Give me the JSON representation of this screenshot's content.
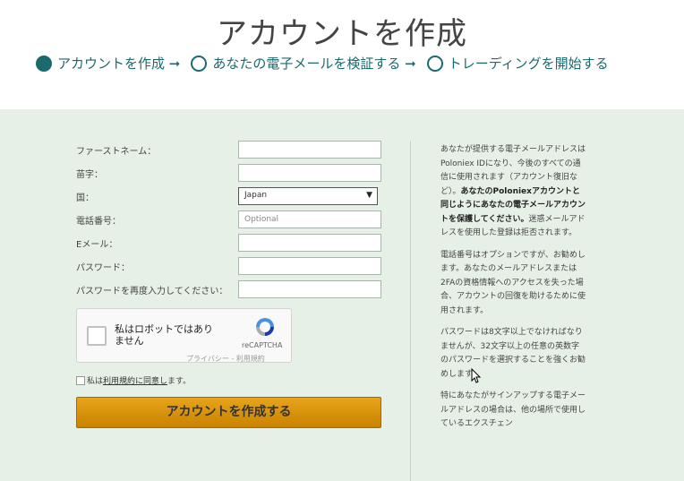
{
  "page_title": "アカウントを作成",
  "steps": [
    {
      "label": "アカウントを作成 ➞",
      "active": true
    },
    {
      "label": "あなたの電子メールを検証する ➞",
      "active": false
    },
    {
      "label": "トレーディングを開始する",
      "active": false
    }
  ],
  "form": {
    "first_name_label": "ファーストネーム：",
    "last_name_label": "苗字：",
    "country_label": "国：",
    "country_value": "Japan",
    "phone_label": "電話番号：",
    "phone_placeholder": "Optional",
    "email_label": "Eメール：",
    "password_label": "パスワード：",
    "password_confirm_label": "パスワードを再度入力してください："
  },
  "captcha": {
    "text": "私はロボットではありません",
    "brand": "reCAPTCHA",
    "links": "プライバシー - 利用規約"
  },
  "agree": {
    "prefix": "私は",
    "link": "利用規約に同意し",
    "suffix": "ます。"
  },
  "submit_label": "アカウントを作成する",
  "help": {
    "p1_a": "あなたが提供する電子メールアドレスはPoloniex IDになり、今後のすべての通信に使用されます（アカウント復旧など）。",
    "p1_b": "あなたのPoloniexアカウントと同じようにあなたの電子メールアカウントを保護してください。",
    "p1_c": "迷惑メールアドレスを使用した登録は拒否されます。",
    "p2": "電話番号はオプションですが、お勧めします。あなたのメールアドレスまたは2FAの資格情報へのアクセスを失った場合、アカウントの回復を助けるために使用されます。",
    "p3": "パスワードは8文字以上でなければなりませんが、32文字以上の任意の英数字のパスワードを選択することを強くお勧めします。",
    "p4": "特にあなたがサインアップする電子メールアドレスの場合は、他の場所で使用しているエクスチェン"
  },
  "colors": {
    "accent": "#1a6a6e",
    "panel_bg": "#e7f0e6",
    "button": "#d99400"
  }
}
